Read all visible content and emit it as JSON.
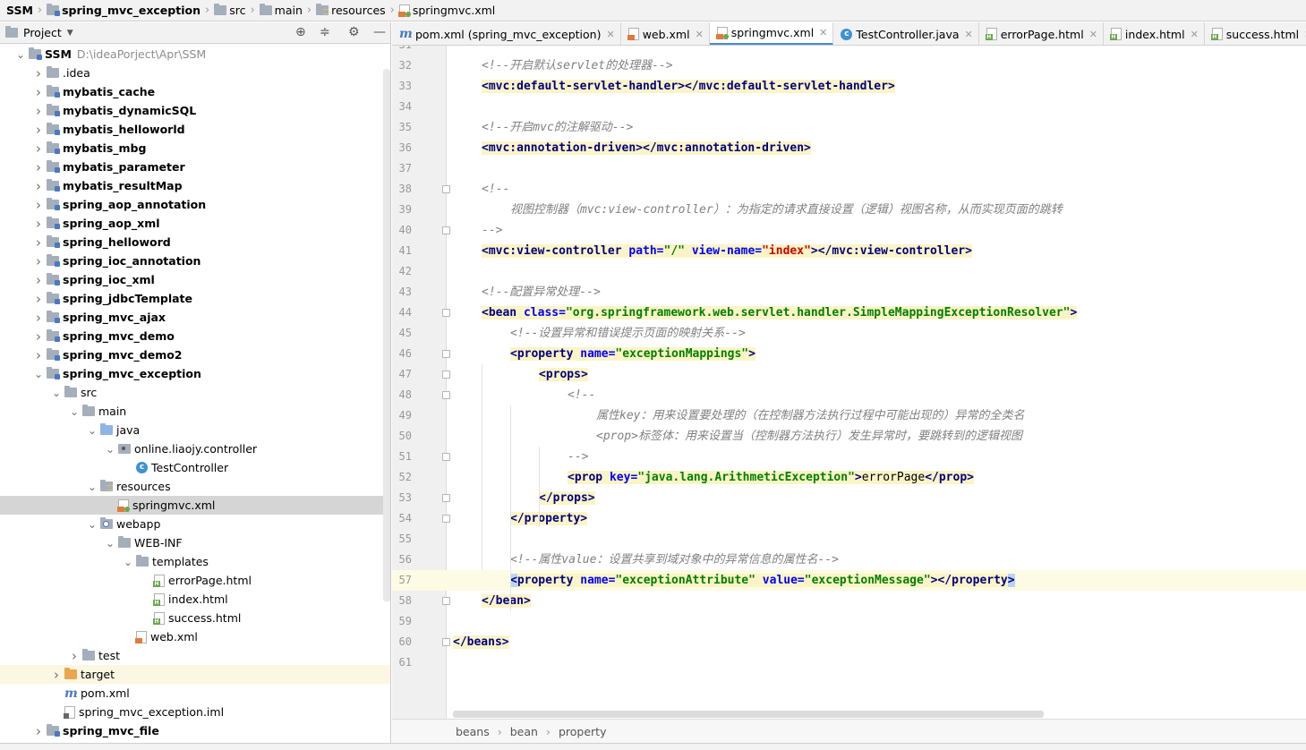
{
  "breadcrumb": [
    "SSM",
    "spring_mvc_exception",
    "src",
    "main",
    "resources",
    "springmvc.xml"
  ],
  "project_panel": {
    "title": "Project",
    "toolbar_icons": [
      "target-icon",
      "collapse-icon",
      "gear-icon",
      "minimize-icon"
    ]
  },
  "tree": [
    {
      "label": "SSM",
      "path": "D:\\ideaPorject\\Apr\\SSM",
      "depth": 0,
      "arrow": "v",
      "icon": "module",
      "bold": true
    },
    {
      "label": ".idea",
      "depth": 1,
      "arrow": ">",
      "icon": "folder",
      "bold": false
    },
    {
      "label": "mybatis_cache",
      "depth": 1,
      "arrow": ">",
      "icon": "module",
      "bold": true
    },
    {
      "label": "mybatis_dynamicSQL",
      "depth": 1,
      "arrow": ">",
      "icon": "module",
      "bold": true
    },
    {
      "label": "mybatis_helloworld",
      "depth": 1,
      "arrow": ">",
      "icon": "module",
      "bold": true
    },
    {
      "label": "mybatis_mbg",
      "depth": 1,
      "arrow": ">",
      "icon": "module",
      "bold": true
    },
    {
      "label": "mybatis_parameter",
      "depth": 1,
      "arrow": ">",
      "icon": "module",
      "bold": true
    },
    {
      "label": "mybatis_resultMap",
      "depth": 1,
      "arrow": ">",
      "icon": "module",
      "bold": true
    },
    {
      "label": "spring_aop_annotation",
      "depth": 1,
      "arrow": ">",
      "icon": "module",
      "bold": true
    },
    {
      "label": "spring_aop_xml",
      "depth": 1,
      "arrow": ">",
      "icon": "module",
      "bold": true
    },
    {
      "label": "spring_helloword",
      "depth": 1,
      "arrow": ">",
      "icon": "module",
      "bold": true
    },
    {
      "label": "spring_ioc_annotation",
      "depth": 1,
      "arrow": ">",
      "icon": "module",
      "bold": true
    },
    {
      "label": "spring_ioc_xml",
      "depth": 1,
      "arrow": ">",
      "icon": "module",
      "bold": true
    },
    {
      "label": "spring_jdbcTemplate",
      "depth": 1,
      "arrow": ">",
      "icon": "module",
      "bold": true
    },
    {
      "label": "spring_mvc_ajax",
      "depth": 1,
      "arrow": ">",
      "icon": "module",
      "bold": true
    },
    {
      "label": "spring_mvc_demo",
      "depth": 1,
      "arrow": ">",
      "icon": "module",
      "bold": true
    },
    {
      "label": "spring_mvc_demo2",
      "depth": 1,
      "arrow": ">",
      "icon": "module",
      "bold": true
    },
    {
      "label": "spring_mvc_exception",
      "depth": 1,
      "arrow": "v",
      "icon": "module",
      "bold": true
    },
    {
      "label": "src",
      "depth": 2,
      "arrow": "v",
      "icon": "folder",
      "bold": false
    },
    {
      "label": "main",
      "depth": 3,
      "arrow": "v",
      "icon": "folder",
      "bold": false
    },
    {
      "label": "java",
      "depth": 4,
      "arrow": "v",
      "icon": "src",
      "bold": false
    },
    {
      "label": "online.liaojy.controller",
      "depth": 5,
      "arrow": "v",
      "icon": "package",
      "bold": false
    },
    {
      "label": "TestController",
      "depth": 6,
      "arrow": "",
      "icon": "java",
      "bold": false
    },
    {
      "label": "resources",
      "depth": 4,
      "arrow": "v",
      "icon": "resources",
      "bold": false
    },
    {
      "label": "springmvc.xml",
      "depth": 5,
      "arrow": "",
      "icon": "springxml",
      "bold": false,
      "selected": true
    },
    {
      "label": "webapp",
      "depth": 4,
      "arrow": "v",
      "icon": "web",
      "bold": false
    },
    {
      "label": "WEB-INF",
      "depth": 5,
      "arrow": "v",
      "icon": "folder",
      "bold": false
    },
    {
      "label": "templates",
      "depth": 6,
      "arrow": "v",
      "icon": "folder",
      "bold": false
    },
    {
      "label": "errorPage.html",
      "depth": 7,
      "arrow": "",
      "icon": "html",
      "bold": false
    },
    {
      "label": "index.html",
      "depth": 7,
      "arrow": "",
      "icon": "html",
      "bold": false
    },
    {
      "label": "success.html",
      "depth": 7,
      "arrow": "",
      "icon": "html",
      "bold": false
    },
    {
      "label": "web.xml",
      "depth": 6,
      "arrow": "",
      "icon": "xml",
      "bold": false
    },
    {
      "label": "test",
      "depth": 3,
      "arrow": ">",
      "icon": "folder",
      "bold": false
    },
    {
      "label": "target",
      "depth": 2,
      "arrow": ">",
      "icon": "target",
      "bold": false,
      "highlight": true
    },
    {
      "label": "pom.xml",
      "depth": 2,
      "arrow": "",
      "icon": "pom",
      "bold": false
    },
    {
      "label": "spring_mvc_exception.iml",
      "depth": 2,
      "arrow": "",
      "icon": "iml",
      "bold": false
    },
    {
      "label": "spring_mvc_file",
      "depth": 1,
      "arrow": ">",
      "icon": "module",
      "bold": true
    }
  ],
  "tabs": [
    {
      "label": "pom.xml (spring_mvc_exception)",
      "icon": "pom",
      "active": false
    },
    {
      "label": "web.xml",
      "icon": "xml",
      "active": false
    },
    {
      "label": "springmvc.xml",
      "icon": "springxml",
      "active": true
    },
    {
      "label": "TestController.java",
      "icon": "java",
      "active": false
    },
    {
      "label": "errorPage.html",
      "icon": "html",
      "active": false
    },
    {
      "label": "index.html",
      "icon": "html",
      "active": false
    },
    {
      "label": "success.html",
      "icon": "html",
      "active": false
    }
  ],
  "editor": {
    "first_line_number": "31",
    "current_line": 57,
    "lines": [
      {
        "n": "32",
        "indent": 1,
        "fold": false,
        "segs": [
          [
            "cm",
            "<!--开启默认servlet的处理器-->"
          ]
        ]
      },
      {
        "n": "33",
        "indent": 1,
        "fold": false,
        "segs": [
          [
            "tgh",
            "<mvc:default-servlet-handler></mvc:default-servlet-handler>"
          ]
        ]
      },
      {
        "n": "34",
        "indent": 0,
        "fold": false,
        "segs": []
      },
      {
        "n": "35",
        "indent": 1,
        "fold": false,
        "segs": [
          [
            "cm",
            "<!--开启mvc的注解驱动-->"
          ]
        ]
      },
      {
        "n": "36",
        "indent": 1,
        "fold": false,
        "segs": [
          [
            "tgh",
            "<mvc:annotation-driven></mvc:annotation-driven>"
          ]
        ]
      },
      {
        "n": "37",
        "indent": 0,
        "fold": false,
        "segs": []
      },
      {
        "n": "38",
        "indent": 1,
        "fold": true,
        "segs": [
          [
            "cm",
            "<!--"
          ]
        ]
      },
      {
        "n": "39",
        "indent": 2,
        "fold": false,
        "segs": [
          [
            "cm",
            "视图控制器（mvc:view-controller）：为指定的请求直接设置（逻辑）视图名称，从而实现页面的跳转"
          ]
        ]
      },
      {
        "n": "40",
        "indent": 1,
        "fold": true,
        "segs": [
          [
            "cm",
            "-->"
          ]
        ]
      },
      {
        "n": "41",
        "indent": 1,
        "fold": false,
        "segs": [
          [
            "tgh",
            "<mvc:view-controller "
          ],
          [
            "ath",
            "path="
          ],
          [
            "avh",
            "\"/\" "
          ],
          [
            "ath",
            "view-name="
          ],
          [
            "avrh",
            "\"index\""
          ],
          [
            "tgh",
            "></mvc:view-controller>"
          ]
        ]
      },
      {
        "n": "42",
        "indent": 0,
        "fold": false,
        "segs": []
      },
      {
        "n": "43",
        "indent": 1,
        "fold": false,
        "segs": [
          [
            "cm",
            "<!--配置异常处理-->"
          ]
        ]
      },
      {
        "n": "44",
        "indent": 1,
        "fold": true,
        "segs": [
          [
            "tgh",
            "<bean "
          ],
          [
            "ath",
            "class="
          ],
          [
            "avh",
            "\"org.springframework.web.servlet.handler.SimpleMappingExceptionResolver\""
          ],
          [
            "tgh",
            ">"
          ]
        ]
      },
      {
        "n": "45",
        "indent": 2,
        "fold": false,
        "segs": [
          [
            "cm",
            "<!--设置异常和错误提示页面的映射关系-->"
          ]
        ]
      },
      {
        "n": "46",
        "indent": 2,
        "fold": true,
        "segs": [
          [
            "tgh",
            "<property "
          ],
          [
            "ath",
            "name="
          ],
          [
            "avh",
            "\"exceptionMappings\""
          ],
          [
            "tgh",
            ">"
          ]
        ]
      },
      {
        "n": "47",
        "indent": 3,
        "fold": true,
        "segs": [
          [
            "tgh",
            "<props>"
          ]
        ]
      },
      {
        "n": "48",
        "indent": 4,
        "fold": true,
        "segs": [
          [
            "cm",
            "<!--"
          ]
        ]
      },
      {
        "n": "49",
        "indent": 5,
        "fold": false,
        "segs": [
          [
            "cm",
            "属性key：用来设置要处理的（在控制器方法执行过程中可能出现的）异常的全类名"
          ]
        ]
      },
      {
        "n": "50",
        "indent": 5,
        "fold": false,
        "segs": [
          [
            "cm",
            "<prop>标签体：用来设置当（控制器方法执行）发生异常时，要跳转到的逻辑视图"
          ]
        ]
      },
      {
        "n": "51",
        "indent": 4,
        "fold": true,
        "segs": [
          [
            "cm",
            "-->"
          ]
        ]
      },
      {
        "n": "52",
        "indent": 4,
        "fold": false,
        "segs": [
          [
            "tgh",
            "<prop "
          ],
          [
            "ath",
            "key="
          ],
          [
            "avh",
            "\"java.lang.ArithmeticException\""
          ],
          [
            "tgh",
            ">"
          ],
          [
            "txh",
            "errorPage"
          ],
          [
            "tgh",
            "</prop>"
          ]
        ]
      },
      {
        "n": "53",
        "indent": 3,
        "fold": true,
        "segs": [
          [
            "tgh",
            "</props>"
          ]
        ]
      },
      {
        "n": "54",
        "indent": 2,
        "fold": true,
        "segs": [
          [
            "tgh",
            "</property>"
          ]
        ]
      },
      {
        "n": "55",
        "indent": 0,
        "fold": false,
        "segs": []
      },
      {
        "n": "56",
        "indent": 2,
        "fold": false,
        "segs": [
          [
            "cm",
            "<!--属性value：设置共享到域对象中的异常信息的属性名-->"
          ]
        ]
      },
      {
        "n": "57",
        "indent": 2,
        "fold": false,
        "segs": [
          [
            "tgc",
            "<"
          ],
          [
            "tgh",
            "property "
          ],
          [
            "ath",
            "name="
          ],
          [
            "avh",
            "\"exceptionAttribute\" "
          ],
          [
            "ath",
            "value="
          ],
          [
            "avh",
            "\"exceptionMessage\""
          ],
          [
            "tgh",
            "></property"
          ],
          [
            "tgc",
            ">"
          ]
        ]
      },
      {
        "n": "58",
        "indent": 1,
        "fold": true,
        "segs": [
          [
            "tgh",
            "</bean>"
          ]
        ]
      },
      {
        "n": "59",
        "indent": 0,
        "fold": false,
        "segs": []
      },
      {
        "n": "60",
        "indent": 0,
        "fold": true,
        "segs": [
          [
            "tgh",
            "</beans>"
          ]
        ]
      },
      {
        "n": "61",
        "indent": 0,
        "fold": false,
        "segs": []
      }
    ]
  },
  "status_breadcrumb": [
    "beans",
    "bean",
    "property"
  ]
}
